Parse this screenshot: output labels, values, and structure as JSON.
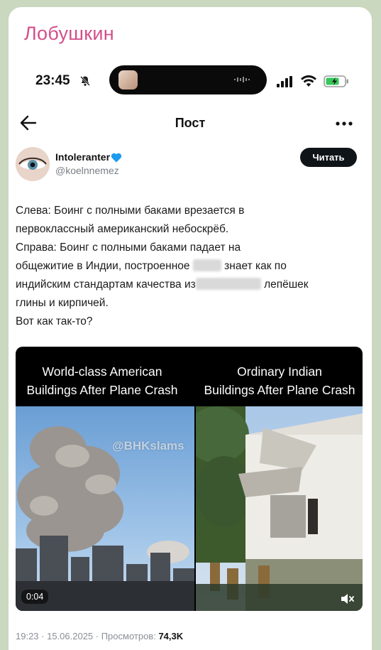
{
  "channel": {
    "name": "Лобушкин"
  },
  "status_bar": {
    "time": "23:45"
  },
  "nav": {
    "title": "Пост"
  },
  "author": {
    "name": "Intoleranter",
    "handle": "@koelnnemez",
    "read_button": "Читать"
  },
  "post": {
    "lines": [
      "Слева: Боинг с полными баками врезается в",
      "первоклассный американский небоскрёб.",
      "Справа: Боинг с полными баками падает на",
      "общежитие в Индии, построенное",
      "знает как по",
      "индийским стандартам качества из",
      "лепёшек",
      "глины и кирпичей.",
      "Вот как так-то?"
    ]
  },
  "media": {
    "caption_left": [
      "World-class American",
      "Buildings After Plane Crash"
    ],
    "caption_right": [
      "Ordinary Indian",
      "Buildings After Plane Crash"
    ],
    "watermark": "@BHKslams",
    "duration": "0:04"
  },
  "meta": {
    "time_date": "19:23 · 15.06.2025 · Просмотров:",
    "views": "74,3K"
  },
  "colors": {
    "channel_accent": "#d2508b",
    "verified_heart": "#1d9bf0"
  },
  "icons": [
    "bell-slash-icon",
    "signal-icon",
    "wifi-icon",
    "battery-icon",
    "back-arrow-icon",
    "more-icon",
    "heart-icon",
    "mute-icon"
  ]
}
